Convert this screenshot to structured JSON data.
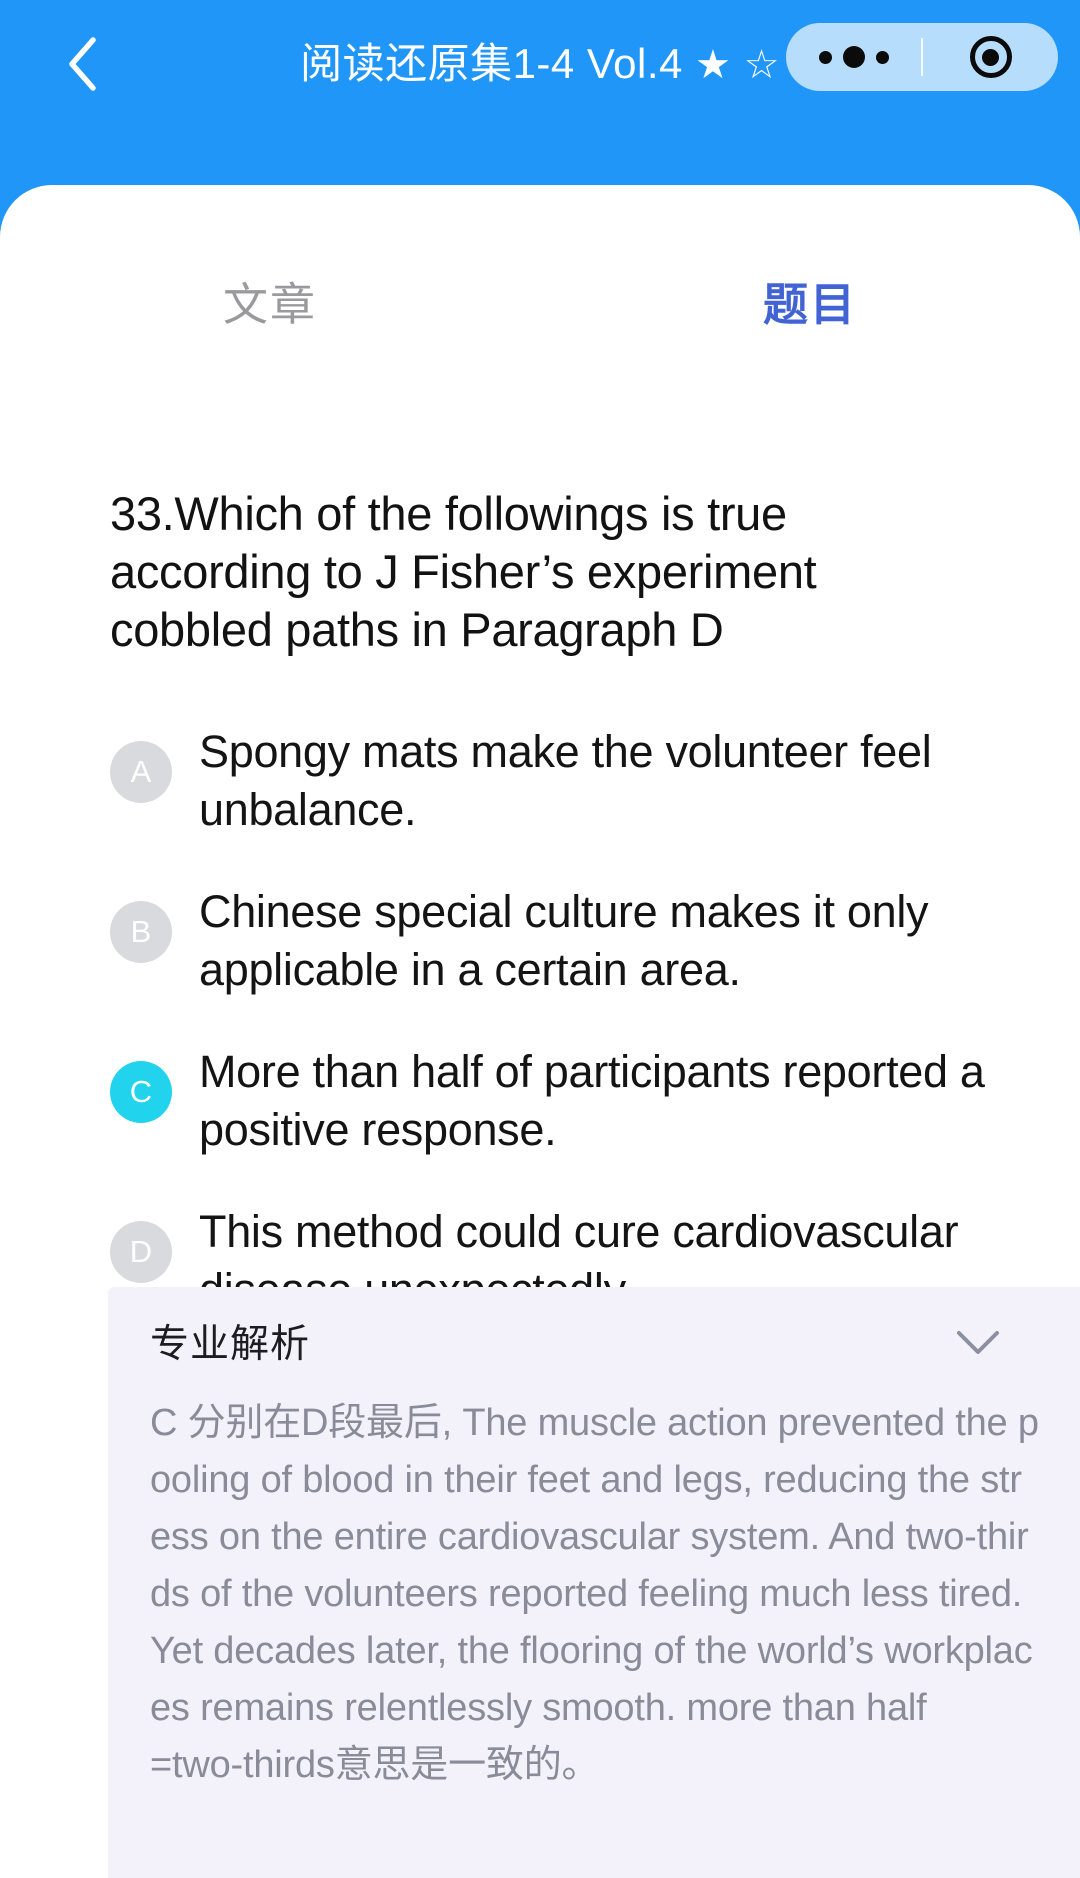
{
  "navbar": {
    "back_icon": "chevron-left-icon",
    "title": "阅读还原集1-4 Vol.4",
    "star_filled": "★",
    "star_hollow": "☆",
    "capsule": {
      "more_icon": "more-dots-icon",
      "target_icon": "target-circle-icon"
    }
  },
  "tabs": [
    {
      "label": "文章",
      "active": false
    },
    {
      "label": "题目",
      "active": true
    }
  ],
  "question": {
    "text": "33.Which of the followings is true according to J Fisher’s experiment cobbled paths in Paragraph D"
  },
  "options": [
    {
      "letter": "A",
      "text": "Spongy mats make the volunteer feel unbalance.",
      "selected": false
    },
    {
      "letter": "B",
      "text": "Chinese special culture makes it only applicable in a certain area.",
      "selected": false
    },
    {
      "letter": "C",
      "text": "More than half of participants reported a positive response.",
      "selected": true
    },
    {
      "letter": "D",
      "text": "This method could cure cardiovascular disease unexpectedly.",
      "selected": false
    }
  ],
  "analysis": {
    "title": "专业解析",
    "toggle_icon": "chevron-down-icon",
    "body_line_1": "C 分别在D段最后, The muscle action prevented the pooling of blood in their feet and legs, reducing the stress on the entire cardiovascular system. And two-thirds of the volunteers reported feeling much less tired. Yet decades later, the flooring of the world’s workplaces remains relentlessly smooth. more than half",
    "body_line_2": "=two-thirds意思是一致的。"
  },
  "colors": {
    "header_blue": "#2196f9",
    "tab_active": "#4263d4",
    "tab_inactive": "#9a9a9e",
    "badge_default": "#d9dade",
    "badge_selected": "#22d3ee",
    "panel_bg": "#f3f2fb",
    "analysis_text": "#8a8a99",
    "sheet_bg": "#ffffff"
  }
}
